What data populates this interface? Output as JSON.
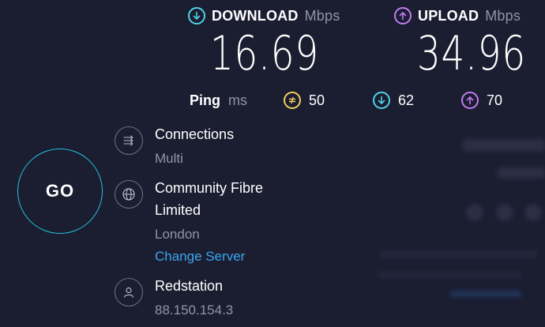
{
  "download": {
    "title": "DOWNLOAD",
    "unit": "Mbps",
    "value": "16.69",
    "icon": "arrow-down-circle-icon",
    "color": "#4fd3e6"
  },
  "upload": {
    "title": "UPLOAD",
    "unit": "Mbps",
    "value": "34.96",
    "icon": "arrow-up-circle-icon",
    "color": "#c27cf0"
  },
  "ping": {
    "label": "Ping",
    "unit": "ms",
    "idle": {
      "value": "50",
      "icon": "ping-idle-icon",
      "color": "#f2d15c"
    },
    "download": {
      "value": "62",
      "icon": "ping-download-icon",
      "color": "#4fd3e6"
    },
    "upload": {
      "value": "70",
      "icon": "ping-upload-icon",
      "color": "#c27cf0"
    }
  },
  "go_button": {
    "label": "GO",
    "accent": "#24c3dc"
  },
  "connections": {
    "title": "Connections",
    "value": "Multi",
    "icon": "connections-icon"
  },
  "server": {
    "title_line1": "Community Fibre",
    "title_line2": "Limited",
    "location": "London",
    "change_label": "Change Server",
    "icon": "globe-icon"
  },
  "provider": {
    "name": "Redstation",
    "ip": "88.150.154.3",
    "icon": "user-icon"
  },
  "colors": {
    "background": "#1b1d31",
    "link": "#3aa7f0",
    "muted": "#9193a8"
  }
}
